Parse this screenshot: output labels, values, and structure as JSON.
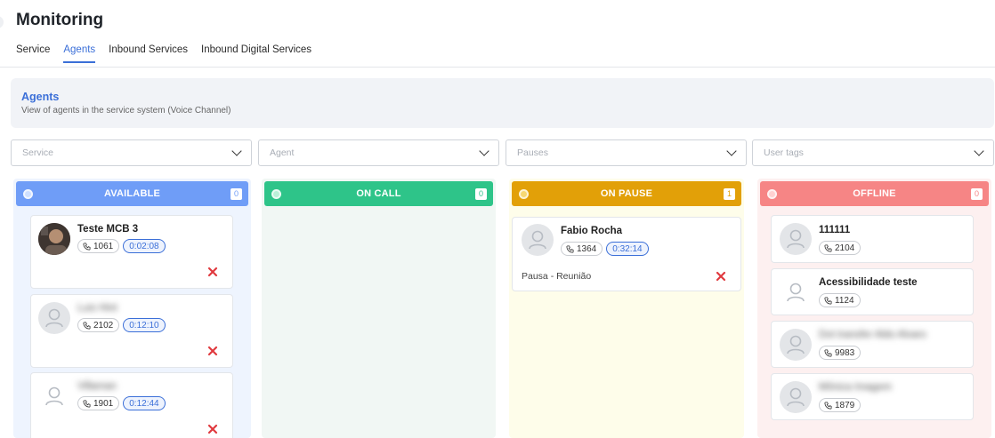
{
  "page": {
    "title": "Monitoring"
  },
  "tabs": [
    {
      "label": "Service",
      "active": false
    },
    {
      "label": "Agents",
      "active": true
    },
    {
      "label": "Inbound Services",
      "active": false
    },
    {
      "label": "Inbound Digital Services",
      "active": false
    }
  ],
  "banner": {
    "title": "Agents",
    "subtitle": "View of agents in the service system (Voice Channel)"
  },
  "filters": [
    {
      "placeholder": "Service"
    },
    {
      "placeholder": "Agent"
    },
    {
      "placeholder": "Pauses"
    },
    {
      "placeholder": "User tags"
    }
  ],
  "colors": {
    "accent": "#3b6fd8",
    "available": "#6f9df7",
    "on_call": "#2ec489",
    "on_pause": "#e2a008",
    "offline": "#f68585",
    "remove": "#e0393e"
  },
  "columns": {
    "available": {
      "title": "AVAILABLE",
      "count": "0",
      "agents": [
        {
          "name": "Teste MCB 3",
          "extension": "1061",
          "timer": "0:02:08",
          "avatar": "photo"
        },
        {
          "name": "Luis Hint",
          "extension": "2102",
          "timer": "0:12:10",
          "avatar": "user-icon"
        },
        {
          "name": "Villaman",
          "extension": "1901",
          "timer": "0:12:44",
          "avatar": "user-icon"
        }
      ]
    },
    "on_call": {
      "title": "ON CALL",
      "count": "0",
      "agents": []
    },
    "on_pause": {
      "title": "ON PAUSE",
      "count": "1",
      "agents": [
        {
          "name": "Fabio Rocha",
          "extension": "1364",
          "timer": "0:32:14",
          "pause_reason": "Pausa - Reunião",
          "avatar": "user-icon"
        }
      ]
    },
    "offline": {
      "title": "OFFLINE",
      "count": "0",
      "agents": [
        {
          "name": "111111",
          "extension": "2104",
          "avatar": "user-icon"
        },
        {
          "name": "Acessibilidade teste",
          "extension": "1124",
          "avatar": "user-icon"
        },
        {
          "name": "Dot transfer Aldo Alvaro",
          "extension": "9983",
          "avatar": "user-icon"
        },
        {
          "name": "Mônica Imagem",
          "extension": "1879",
          "avatar": "user-icon"
        }
      ]
    }
  }
}
